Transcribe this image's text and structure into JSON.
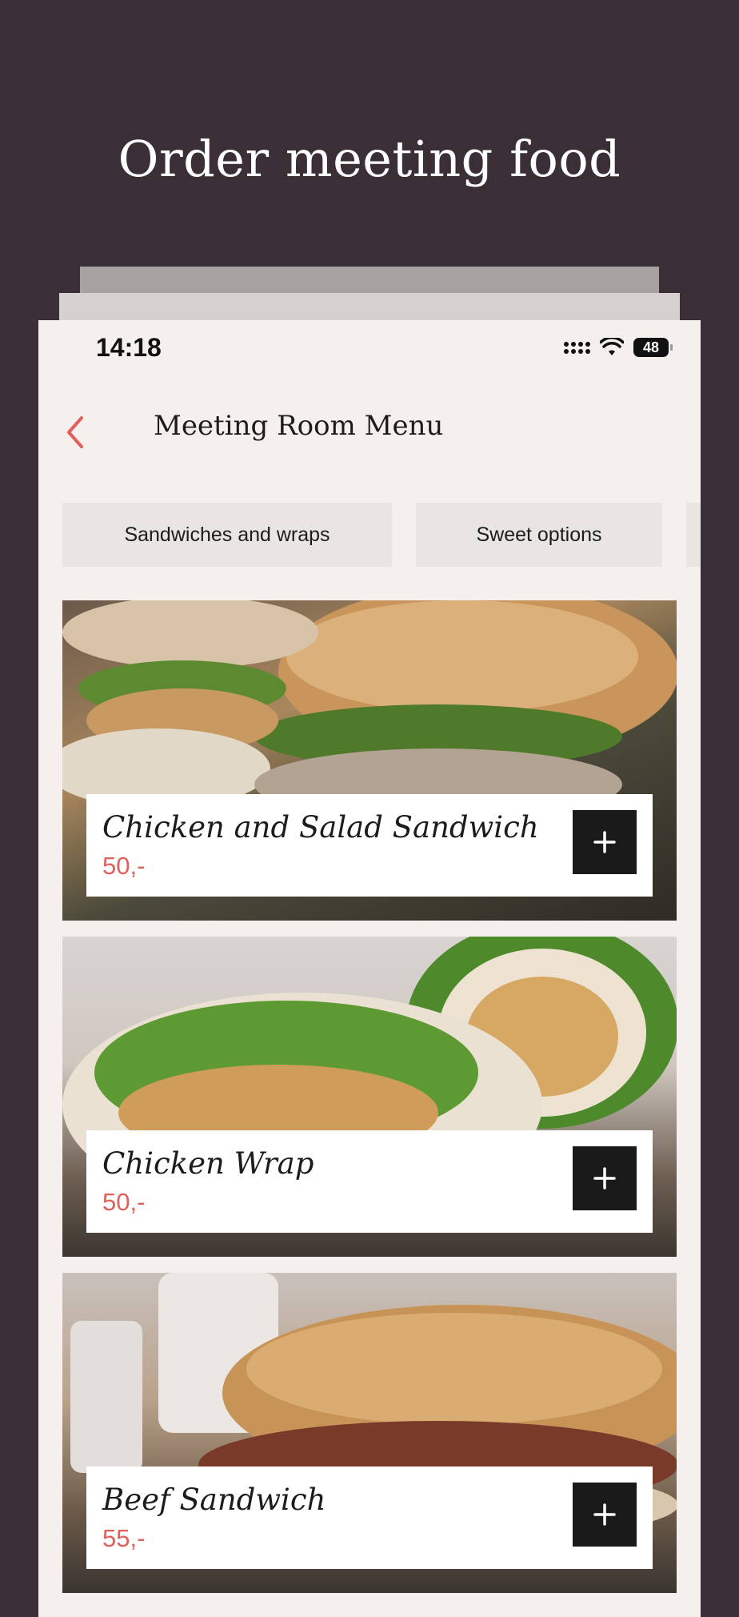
{
  "headline": "Order meeting food",
  "status_bar": {
    "time": "14:18",
    "battery": "48"
  },
  "nav": {
    "title": "Meeting Room Menu"
  },
  "categories": [
    "Sandwiches and wraps",
    "Sweet options"
  ],
  "items": [
    {
      "name": "Chicken and Salad Sandwich",
      "price": "50,-"
    },
    {
      "name": "Chicken Wrap",
      "price": "50,-"
    },
    {
      "name": "Beef Sandwich",
      "price": "55,-"
    }
  ],
  "colors": {
    "background": "#3a2e37",
    "accent": "#e0605a",
    "surface": "#f5f0ee",
    "button": "#1a1a1a"
  },
  "icons": {
    "back": "chevron-left-icon",
    "add": "plus-icon"
  }
}
